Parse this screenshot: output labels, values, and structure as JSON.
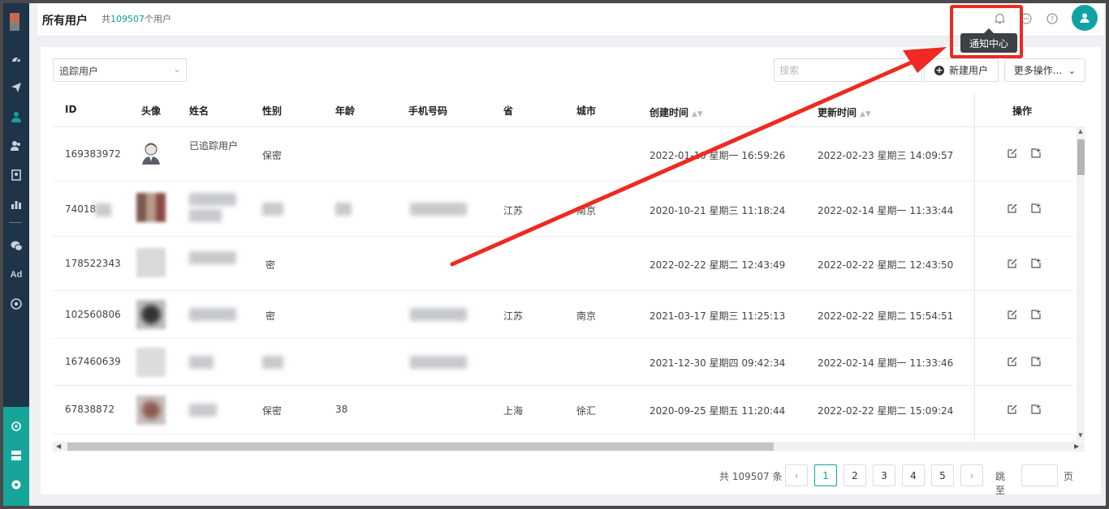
{
  "header": {
    "title": "所有用户",
    "count_prefix": "共",
    "count_value": "109507",
    "count_suffix": "个用户",
    "icons": [
      "bell-icon",
      "chat-icon",
      "help-icon",
      "user-avatar-icon"
    ]
  },
  "tooltip": {
    "text": "通知中心"
  },
  "sidebar": {
    "items": [
      "dashboard-icon",
      "send-icon",
      "user-icon",
      "users-icon",
      "bookmark-icon",
      "chart-icon",
      "wechat-icon",
      "ad-icon",
      "target-icon"
    ],
    "ad_label": "Ad",
    "bottom_items": [
      "sync-icon",
      "server-icon",
      "settings-icon"
    ]
  },
  "toolbar": {
    "filter_value": "追踪用户",
    "search_placeholder": "搜索",
    "new_user_label": "新建用户",
    "more_label": "更多操作..."
  },
  "table": {
    "headers": [
      "ID",
      "头像",
      "姓名",
      "性别",
      "年龄",
      "手机号码",
      "省",
      "城市",
      "创建时间",
      "更新时间",
      "操作"
    ],
    "rows": [
      {
        "id": "169383972",
        "name": "已追踪用户",
        "gender": "保密",
        "age": "",
        "phone": "",
        "province": "",
        "city": "",
        "created": "2022-01-10 星期一 16:59:26",
        "updated": "2022-02-23 星期三 14:09:57"
      },
      {
        "id": "74018",
        "name": "",
        "gender": "",
        "age": "",
        "phone": "",
        "province": "江苏",
        "city": "南京",
        "created": "2020-10-21 星期三 11:18:24",
        "updated": "2022-02-14 星期一 11:33:44"
      },
      {
        "id": "178522343",
        "name": "",
        "gender": "密",
        "age": "",
        "phone": "",
        "province": "",
        "city": "",
        "created": "2022-02-22 星期二 12:43:49",
        "updated": "2022-02-22 星期二 12:43:50"
      },
      {
        "id": "102560806",
        "name": "",
        "gender": "密",
        "age": "",
        "phone": "",
        "province": "江苏",
        "city": "南京",
        "created": "2021-03-17 星期三 11:25:13",
        "updated": "2022-02-22 星期二 15:54:51"
      },
      {
        "id": "167460639",
        "name": "",
        "gender": "",
        "age": "",
        "phone": "",
        "province": "",
        "city": "",
        "created": "2021-12-30 星期四 09:42:34",
        "updated": "2022-02-14 星期一 11:33:46"
      },
      {
        "id": "67838872",
        "name": "",
        "gender": "保密",
        "age": "38",
        "phone": "",
        "province": "上海",
        "city": "徐汇",
        "created": "2020-09-25 星期五 11:20:44",
        "updated": "2022-02-22 星期二 15:09:24"
      }
    ]
  },
  "pagination": {
    "total_text": "共 109507 条",
    "prev": "‹",
    "next": "›",
    "pages": [
      "1",
      "2",
      "3",
      "4",
      "5"
    ],
    "current": "1",
    "jump_label": "跳至",
    "page_unit": "页"
  },
  "colors": {
    "accent": "#11a3a3",
    "sidebar": "#1f3448",
    "annotation": "#ee2a22"
  }
}
